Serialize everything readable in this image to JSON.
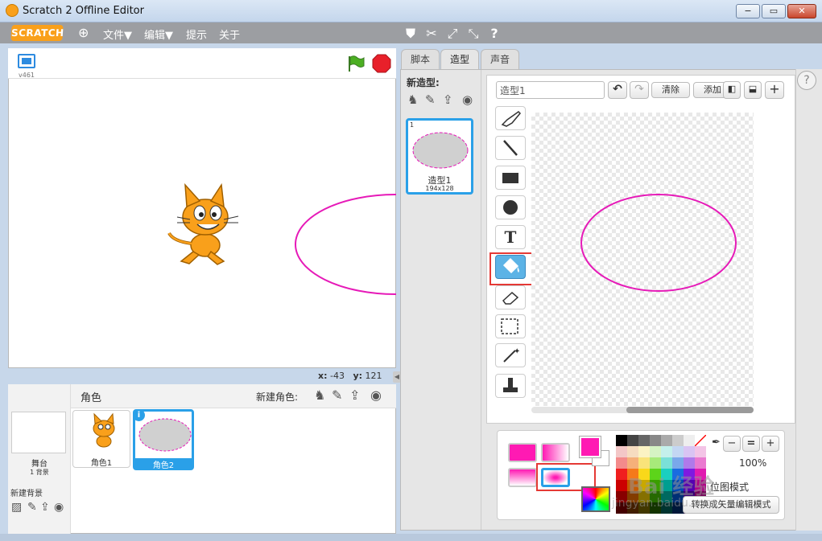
{
  "window": {
    "title": "Scratch 2 Offline Editor",
    "min": "−",
    "max": "▭",
    "close": "✕"
  },
  "menubar": {
    "logo": "SCRATCH",
    "globe": "⊕",
    "file": "文件▼",
    "edit": "编辑▼",
    "tips": "提示",
    "about": "关于",
    "tools": [
      "⛊",
      "✂",
      "⤢",
      "⤡",
      "?"
    ]
  },
  "stage": {
    "version": "v461",
    "x_label": "x:",
    "x_value": "-43",
    "y_label": "y:",
    "y_value": "121"
  },
  "sprites": {
    "header": "角色",
    "new_sprite": "新建角色:",
    "stage_label": "舞台",
    "backdrop_count": "1 背景",
    "new_backdrop": "新建背景",
    "items": [
      {
        "name": "角色1"
      },
      {
        "name": "角色2"
      }
    ]
  },
  "tabs": {
    "scripts": "脚本",
    "costumes": "造型",
    "sounds": "声音"
  },
  "costumes": {
    "new_costume": "新造型:",
    "index": "1",
    "name": "造型1",
    "size": "194x128"
  },
  "paint": {
    "name_value": "造型1",
    "clear": "清除",
    "add": "添加",
    "zoom": "100%",
    "mode_hint": "位图模式",
    "convert": "转换成矢量编辑模式",
    "colors": {
      "primary": "#ff1ab3",
      "ellipse_stroke": "#e61ab8"
    }
  },
  "watermark": {
    "main": "Bai 经验",
    "sub": "jingyan.baidu.com"
  }
}
